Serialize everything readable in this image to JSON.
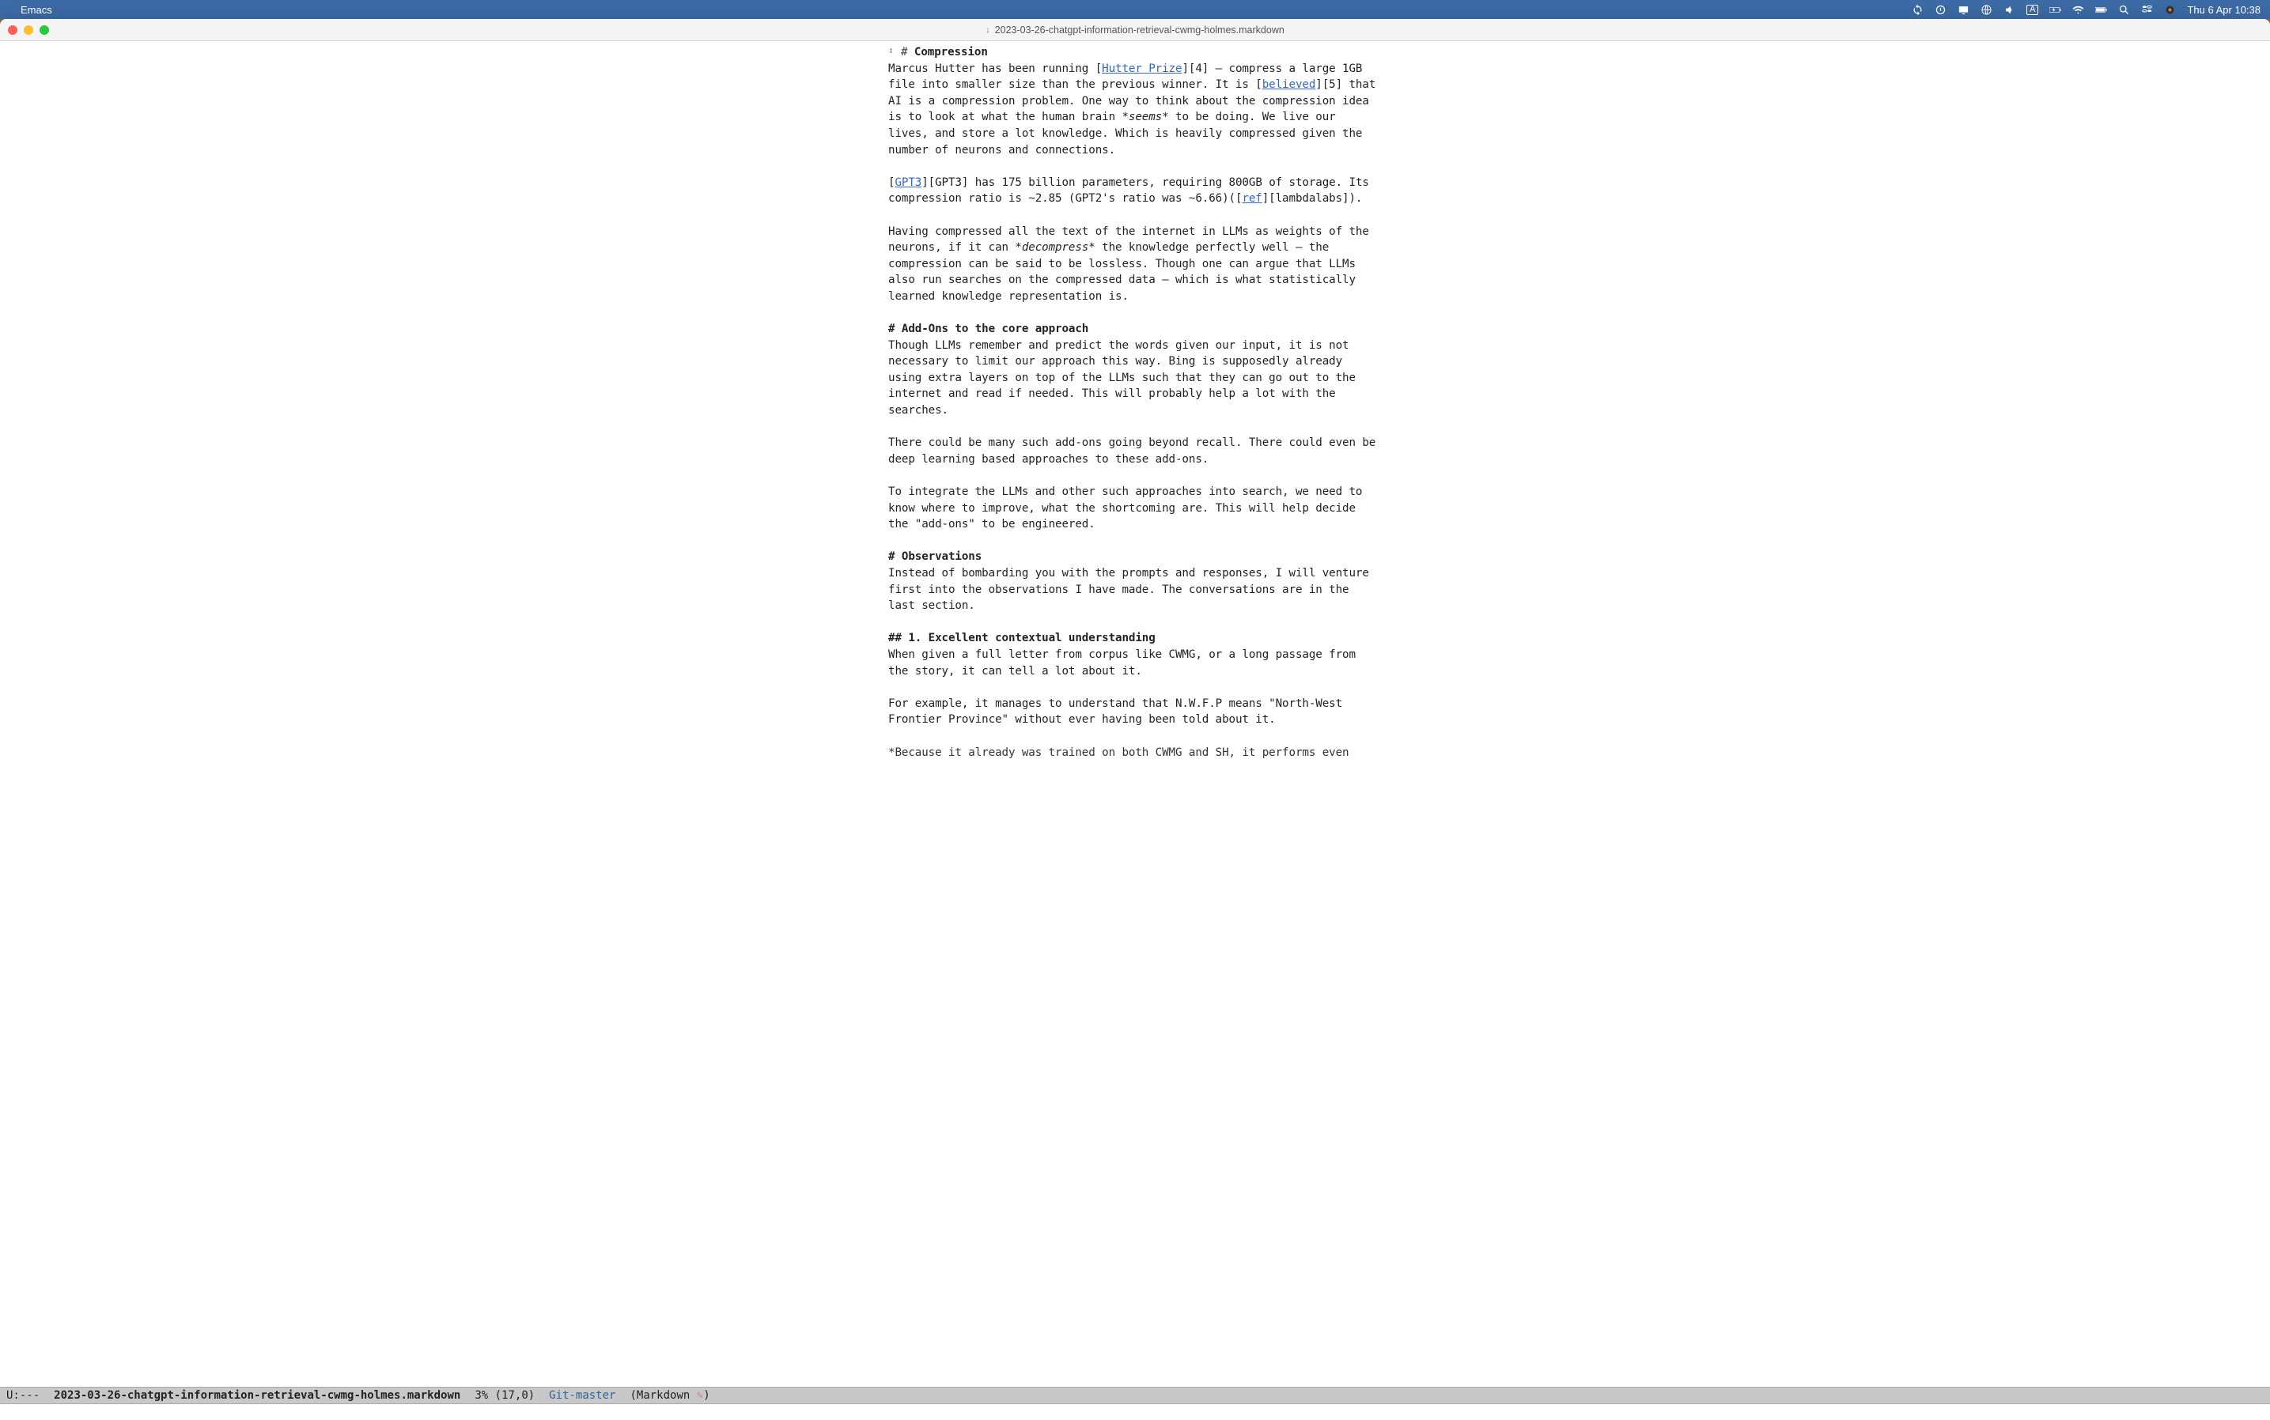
{
  "menubar": {
    "app_name": "Emacs",
    "clock": "Thu 6 Apr  10:38"
  },
  "window": {
    "title": "2023-03-26-chatgpt-information-retrieval-cwmg-holmes.markdown"
  },
  "doc": {
    "h_compression": "# Compression",
    "p1_pre": "Marcus Hutter has been running [",
    "p1_link1": "Hutter Prize",
    "p1_mid1": "][4] – compress a large 1GB file into smaller size than the previous winner. It is [",
    "p1_link2": "believed",
    "p1_mid2": "][5] that AI is a compression problem. One way to think about the compression idea is to look at what the human brain ",
    "p1_em1": "*seems*",
    "p1_mid3": " to be doing. We live our lives, and store a lot knowledge. Which is heavily compressed given the number of neurons and connections.",
    "p2_pre": "[",
    "p2_link1": "GPT3",
    "p2_mid1": "][GPT3] has 175 billion parameters, requiring 800GB of storage. Its compression ratio is ~2.85 (GPT2's ratio was ~6.66)([",
    "p2_link2": "ref",
    "p2_mid2": "][lambdalabs]).",
    "p3_pre": "Having compressed all the text of the internet in LLMs as weights of the neurons, if it can ",
    "p3_em1": "*decompress*",
    "p3_post": " the knowledge perfectly well – the compression can be said to be lossless. Though one can argue that LLMs also run searches on the compressed data – which is what statistically learned knowledge representation is.",
    "h_addons": "# Add-Ons to the core approach",
    "p4": "Though LLMs remember and predict the words given our input, it is not necessary to limit our approach this way. Bing is supposedly already using extra layers on top of the LLMs such that they can go out to the internet and read if needed. This will probably help a lot with the searches.",
    "p5": "There could be many such add-ons going beyond recall. There could even be deep learning based approaches to these add-ons.",
    "p6": "To integrate the LLMs and other such approaches into search, we need to know where to improve, what the shortcoming are. This will help decide the \"add-ons\" to be engineered.",
    "h_obs": "# Observations",
    "p7": "Instead of bombarding you with the prompts and responses, I will venture first into the observations I have made. The conversations are in the last section.",
    "h_sub1": "## 1. Excellent contextual understanding",
    "p8": "When given a full letter from corpus like CWMG, or a long passage from the story, it can tell a lot about it.",
    "p9": "For example, it manages to understand that N.W.F.P means \"North-West Frontier Province\" without ever having been told about it.",
    "p10_cut": "*Because it already was trained on both CWMG and SH, it performs even"
  },
  "modeline": {
    "status": "U:---",
    "buffer": "2023-03-26-chatgpt-information-retrieval-cwmg-holmes.markdown",
    "position": "3% (17,0)",
    "git": "Git-master",
    "mode_open": "(Markdown ",
    "mode_close": ")"
  }
}
